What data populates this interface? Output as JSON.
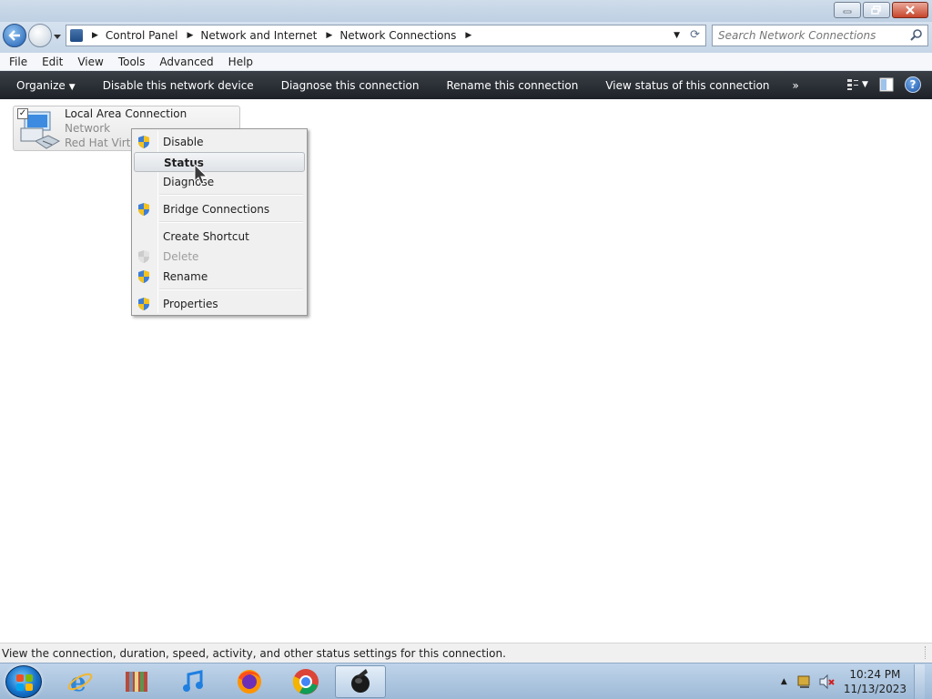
{
  "window": {
    "minimize_glyph": "",
    "maximize_glyph": "",
    "close_glyph": ""
  },
  "address": {
    "crumbs": [
      "Control Panel",
      "Network and Internet",
      "Network Connections"
    ]
  },
  "search": {
    "placeholder": "Search Network Connections"
  },
  "menubar": [
    "File",
    "Edit",
    "View",
    "Tools",
    "Advanced",
    "Help"
  ],
  "commandbar": {
    "organize": "Organize",
    "disable": "Disable this network device",
    "diagnose": "Diagnose this connection",
    "rename": "Rename this connection",
    "view_status": "View status of this connection",
    "more": "»"
  },
  "connection": {
    "name": "Local Area Connection",
    "network": "Network",
    "adapter": "Red Hat VirtIO"
  },
  "context_menu": {
    "items": [
      {
        "label": "Disable",
        "shield": true,
        "state": "normal"
      },
      {
        "label": "Status",
        "shield": false,
        "state": "hover"
      },
      {
        "label": "Diagnose",
        "shield": false,
        "state": "normal"
      },
      {
        "label": "Bridge Connections",
        "shield": true,
        "state": "normal"
      },
      {
        "label": "Create Shortcut",
        "shield": false,
        "state": "normal"
      },
      {
        "label": "Delete",
        "shield": true,
        "state": "disabled"
      },
      {
        "label": "Rename",
        "shield": true,
        "state": "normal"
      },
      {
        "label": "Properties",
        "shield": true,
        "state": "normal"
      }
    ]
  },
  "statusbar": {
    "text": "View the connection, duration, speed, activity, and other status settings for this connection."
  },
  "taskbar": {
    "apps": [
      "internet-explorer-icon",
      "archive-manager-icon",
      "itunes-icon",
      "firefox-icon",
      "chrome-icon",
      "network-app-icon"
    ],
    "clock_time": "10:24 PM",
    "clock_date": "11/13/2023"
  },
  "colors": {
    "cmdbar": "#2a2f36",
    "title": "#c6d6e8",
    "taskbar": "#a9c3de"
  }
}
